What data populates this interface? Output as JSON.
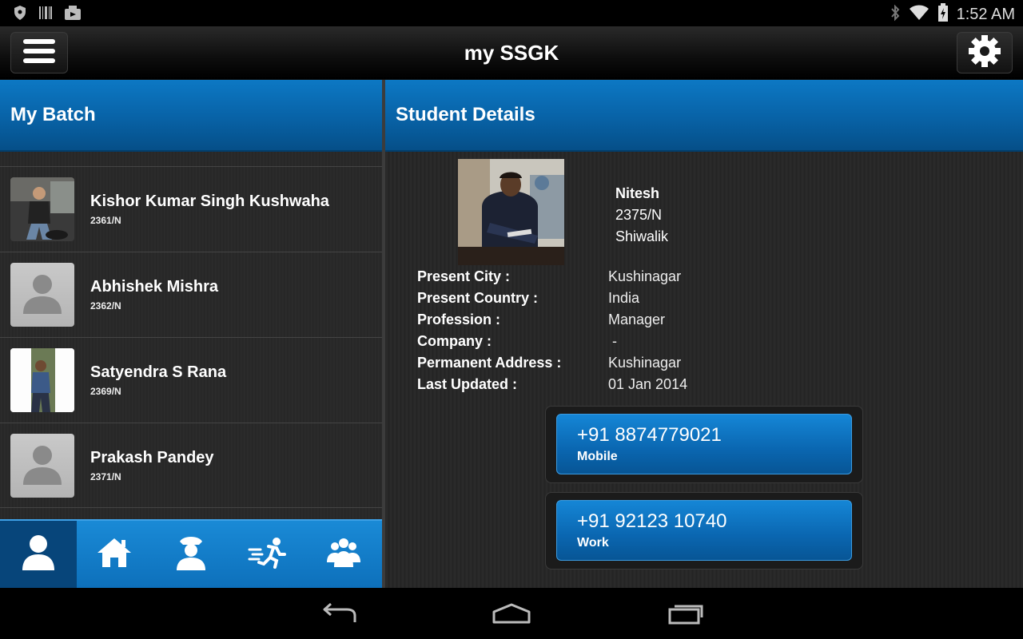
{
  "status_bar": {
    "time": "1:52 AM",
    "left_icons": [
      "shield-icon",
      "barcode-icon",
      "gallery-icon"
    ],
    "right_icons": [
      "bluetooth-icon",
      "wifi-icon",
      "battery-charging-icon"
    ]
  },
  "action_bar": {
    "title": "my SSGK",
    "menu_icon": "hamburger-menu-icon",
    "settings_icon": "gear-icon"
  },
  "left_pane": {
    "header": "My Batch",
    "items": [
      {
        "name": "Kishor Kumar Singh Kushwaha",
        "id": "2361/N",
        "has_photo": true
      },
      {
        "name": "Abhishek Mishra",
        "id": "2362/N",
        "has_photo": false
      },
      {
        "name": "Satyendra S Rana",
        "id": "2369/N",
        "has_photo": true
      },
      {
        "name": "Prakash Pandey",
        "id": "2371/N",
        "has_photo": false
      }
    ],
    "tabs": [
      {
        "icon": "person-icon",
        "active": true
      },
      {
        "icon": "home-icon",
        "active": false
      },
      {
        "icon": "officer-icon",
        "active": false
      },
      {
        "icon": "runner-icon",
        "active": false
      },
      {
        "icon": "group-icon",
        "active": false
      }
    ]
  },
  "right_pane": {
    "header": "Student Details",
    "student": {
      "name": "Nitesh",
      "id": "2375/N",
      "house": "Shiwalik"
    },
    "details": [
      {
        "label": "Present City :",
        "value": "Kushinagar"
      },
      {
        "label": "Present Country :",
        "value": "India"
      },
      {
        "label": "Profession :",
        "value": "Manager"
      },
      {
        "label": "Company  :",
        "value": " -"
      },
      {
        "label": "Permanent Address :",
        "value": "Kushinagar"
      },
      {
        "label": "Last Updated :",
        "value": "01 Jan 2014"
      }
    ],
    "phones": [
      {
        "number": "+91 8874779021",
        "type": "Mobile"
      },
      {
        "number": "+91 92123 10740",
        "type": "Work"
      }
    ]
  },
  "nav_bar": {
    "icons": [
      "back-icon",
      "home-nav-icon",
      "recent-apps-icon"
    ]
  },
  "colors": {
    "accent_blue": "#0862a6",
    "tab_active": "#07457a",
    "background": "#272727"
  }
}
